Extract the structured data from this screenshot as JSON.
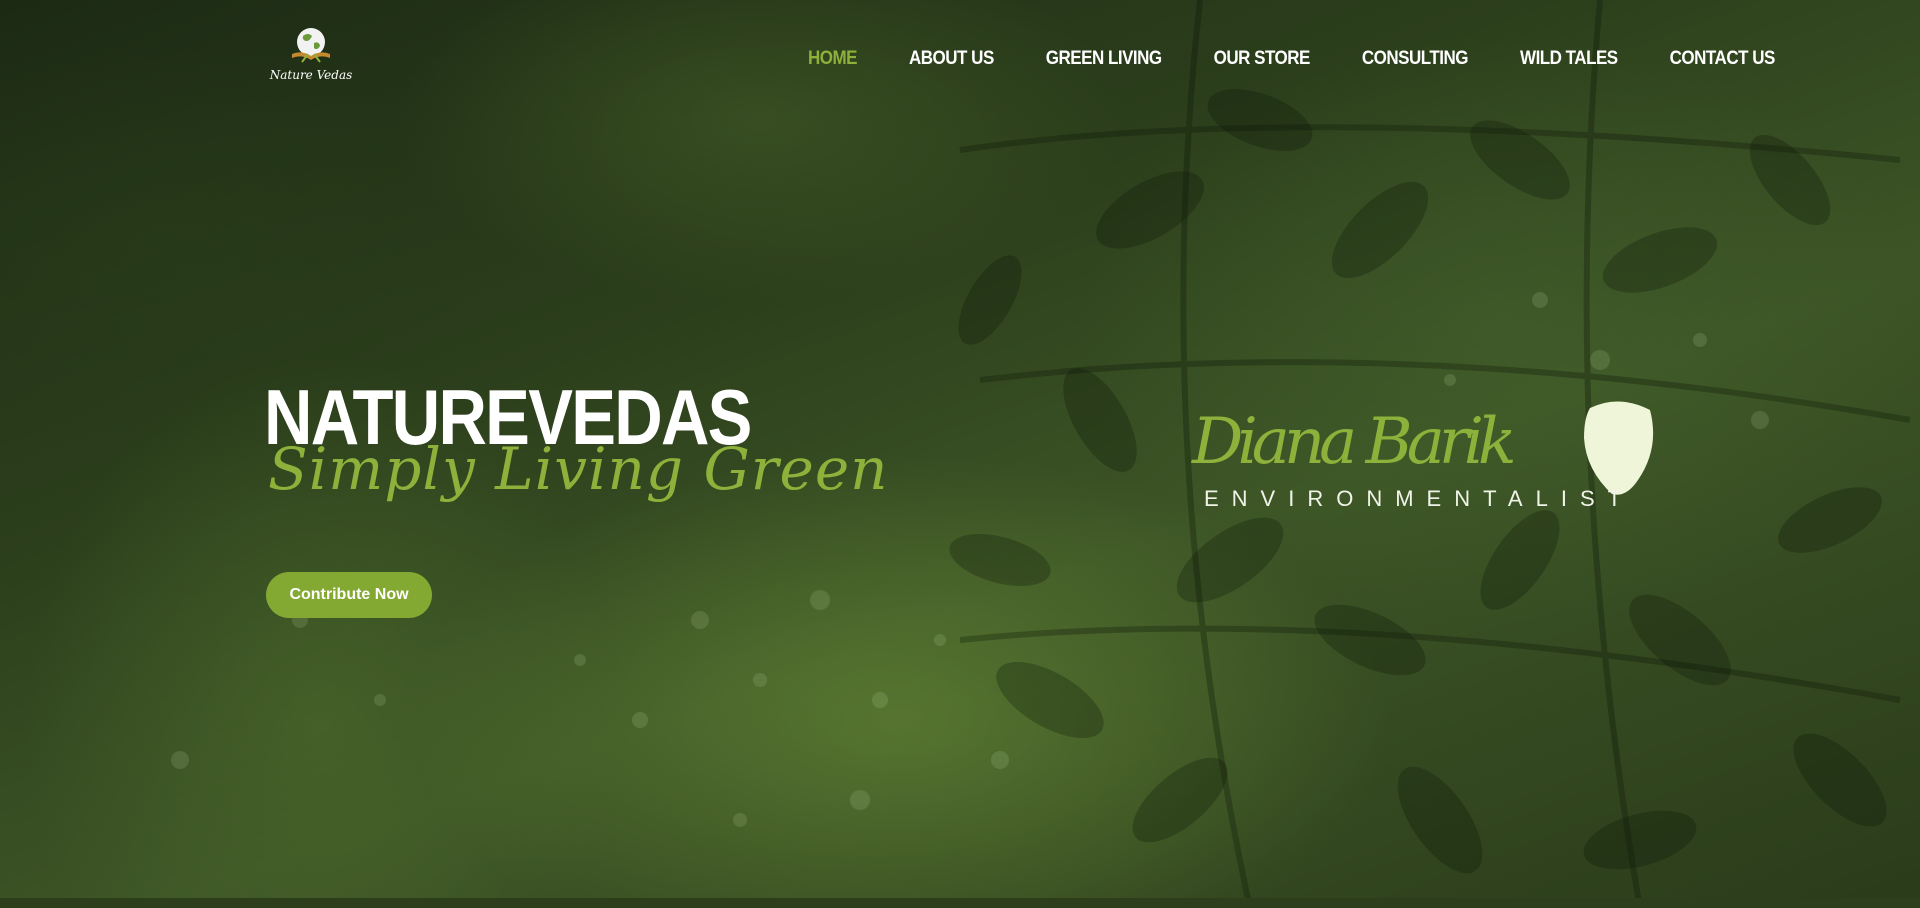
{
  "brand": {
    "logo_text": "Nature Vedas"
  },
  "nav": {
    "items": [
      {
        "label": "HOME",
        "active": true
      },
      {
        "label": "ABOUT US",
        "active": false
      },
      {
        "label": "GREEN LIVING",
        "active": false
      },
      {
        "label": "OUR STORE",
        "active": false
      },
      {
        "label": "CONSULTING",
        "active": false
      },
      {
        "label": "WILD TALES",
        "active": false
      },
      {
        "label": "CONTACT US",
        "active": false
      }
    ]
  },
  "hero": {
    "headline": "NATUREVEDAS",
    "tagline": "Simply Living Green",
    "cta_label": "Contribute Now",
    "signature_name": "Diana Barik",
    "signature_role": "ENVIRONMENTALIST"
  },
  "colors": {
    "accent": "#8db13a",
    "button": "#84a932",
    "text_light": "#ffffff",
    "background_dark": "#1c2a14"
  },
  "icons": {
    "logo": "globe-book-icon",
    "signature_leaf": "leaf-icon"
  }
}
